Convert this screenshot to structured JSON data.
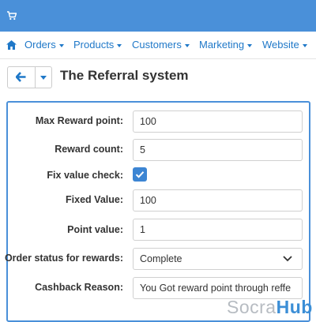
{
  "colors": {
    "topbar": "#4a90d9",
    "link": "#1f78c8",
    "accent": "#3c85d3",
    "panel_border": "#4a90d9"
  },
  "topbar": {
    "icon": "cart-icon"
  },
  "nav": {
    "home_icon": "home-icon",
    "items": [
      {
        "label": "Orders"
      },
      {
        "label": "Products"
      },
      {
        "label": "Customers"
      },
      {
        "label": "Marketing"
      },
      {
        "label": "Website"
      }
    ]
  },
  "header": {
    "back_icon": "arrow-left-icon",
    "title": "The Referral system"
  },
  "form": {
    "max_reward_point": {
      "label": "Max Reward point:",
      "value": "100"
    },
    "reward_count": {
      "label": "Reward count:",
      "value": "5"
    },
    "fix_value_check": {
      "label": "Fix value check:",
      "checked": true
    },
    "fixed_value": {
      "label": "Fixed Value:",
      "value": "100"
    },
    "point_value": {
      "label": "Point value:",
      "value": "1"
    },
    "order_status": {
      "label": "Order status for rewards:",
      "value": "Complete"
    },
    "cashback_reason": {
      "label": "Cashback Reason:",
      "value": "You Got reward point  through reffe"
    }
  },
  "watermark": {
    "part1": "Socra",
    "part2": "Hub"
  }
}
